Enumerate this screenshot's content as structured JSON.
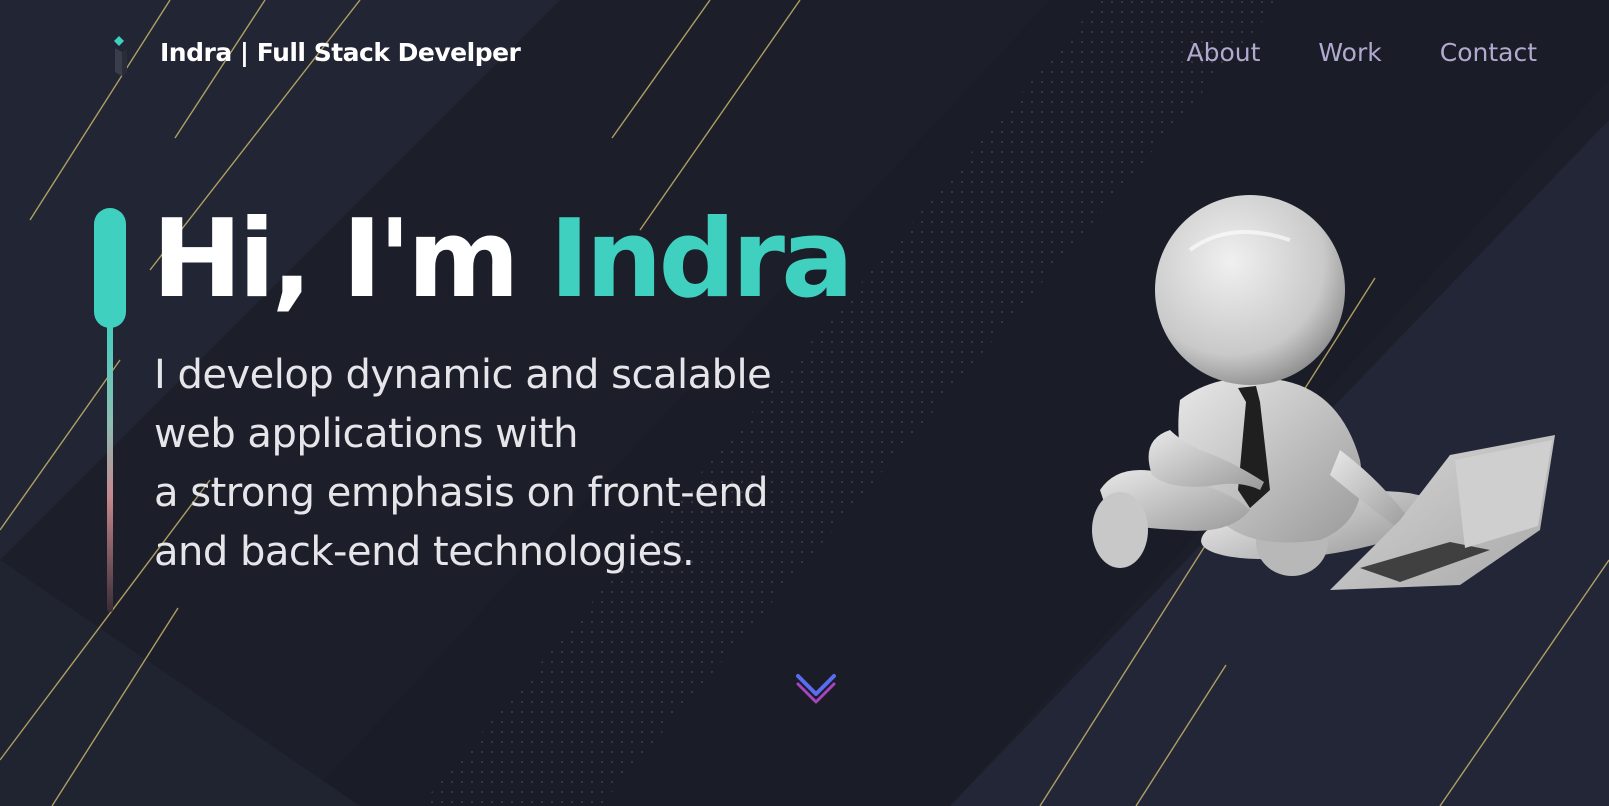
{
  "header": {
    "brand": "Indra  | Full Stack Develper",
    "nav": [
      {
        "label": "About"
      },
      {
        "label": "Work"
      },
      {
        "label": "Contact"
      }
    ]
  },
  "hero": {
    "greeting": "Hi, I'm ",
    "name": "Indra",
    "subtitle_lines": [
      "I develop dynamic and scalable",
      "web applications with",
      "a strong emphasis on front-end",
      "and back-end technologies."
    ]
  },
  "icons": {
    "logo": "logo-icon",
    "scroll": "chevron-down-icon",
    "illustration": "character-with-laptop-illustration"
  },
  "colors": {
    "background": "#1c1f2a",
    "accent": "#3fd0bf",
    "nav_text": "#b1a9d0",
    "gold_line": "#c9b36a"
  }
}
